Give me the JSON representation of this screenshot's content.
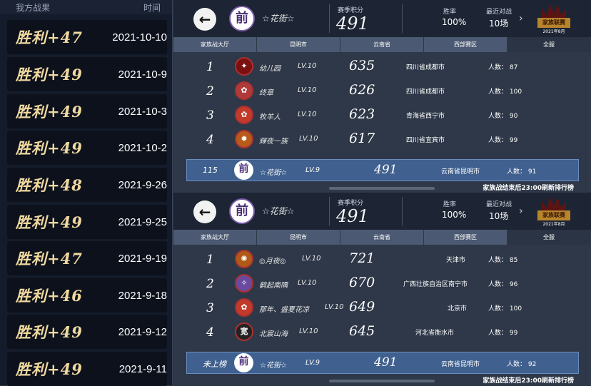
{
  "left": {
    "header_result": "我方战果",
    "header_time": "时间",
    "records": [
      {
        "result": "胜利+47",
        "date": "2021-10-10"
      },
      {
        "result": "胜利+49",
        "date": "2021-10-9"
      },
      {
        "result": "胜利+49",
        "date": "2021-10-3"
      },
      {
        "result": "胜利+49",
        "date": "2021-10-2"
      },
      {
        "result": "胜利+48",
        "date": "2021-9-26"
      },
      {
        "result": "胜利+49",
        "date": "2021-9-25"
      },
      {
        "result": "胜利+47",
        "date": "2021-9-19"
      },
      {
        "result": "胜利+46",
        "date": "2021-9-18"
      },
      {
        "result": "胜利+49",
        "date": "2021-9-12"
      },
      {
        "result": "胜利+49",
        "date": "2021-9-11"
      }
    ]
  },
  "panels": [
    {
      "back_icon": "arrow-left-icon",
      "avatar_char": "前",
      "clan_name": "☆花街☆",
      "season_label": "赛季积分",
      "season_value": "491",
      "win_rate_label": "胜率",
      "win_rate_value": "100%",
      "recent_label": "最近对战",
      "recent_value": "10场",
      "badge_title": "家族联赛",
      "badge_season": "2021年8月",
      "tabs": [
        "家族战大厅",
        "昆明市",
        "云南省",
        "西部赛区",
        "全服"
      ],
      "active_tab": 4,
      "rows": [
        {
          "rank": "1",
          "avatar": "✦",
          "name": "幼儿园",
          "level": "LV.10",
          "score": "635",
          "location": "四川省成都市",
          "people": "人数： 87"
        },
        {
          "rank": "2",
          "avatar": "✿",
          "name": "终章",
          "level": "LV.10",
          "score": "626",
          "location": "四川省成都市",
          "people": "人数： 100"
        },
        {
          "rank": "3",
          "avatar": "✿",
          "name": "牧羊人",
          "level": "LV.10",
          "score": "623",
          "location": "青海省西宁市",
          "people": "人数： 90"
        },
        {
          "rank": "4",
          "avatar": "✹",
          "name": "輝夜一族",
          "level": "LV.10",
          "score": "617",
          "location": "四川省宜宾市",
          "people": "人数： 99"
        }
      ],
      "mine": {
        "rank": "115",
        "avatar": "前",
        "name": "☆花街☆",
        "level": "LV.9",
        "score": "491",
        "location": "云南省昆明市",
        "people": "人数： 91"
      },
      "footer": "家族战结束后23:00刷新排行榜"
    },
    {
      "back_icon": "arrow-left-icon",
      "avatar_char": "前",
      "clan_name": "☆花街☆",
      "season_label": "赛季积分",
      "season_value": "491",
      "win_rate_label": "胜率",
      "win_rate_value": "100%",
      "recent_label": "最近对战",
      "recent_value": "10场",
      "badge_title": "家族联赛",
      "badge_season": "2021年8月",
      "tabs": [
        "家族战大厅",
        "昆明市",
        "云南省",
        "西部赛区",
        "全服"
      ],
      "active_tab": 4,
      "rows": [
        {
          "rank": "1",
          "avatar": "✺",
          "name": "◎月夜◎",
          "level": "LV.10",
          "score": "721",
          "location": "天津市",
          "people": "人数： 85"
        },
        {
          "rank": "2",
          "avatar": "✧",
          "name": "鹤起南隅",
          "level": "LV.10",
          "score": "670",
          "location": "广西壮族自治区南宁市",
          "people": "人数： 96"
        },
        {
          "rank": "3",
          "avatar": "✿",
          "name": "那年、盛夏花凉",
          "level": "LV.10",
          "score": "649",
          "location": "北京市",
          "people": "人数： 100"
        },
        {
          "rank": "4",
          "avatar": "宽",
          "name": "北宸山海",
          "level": "LV.10",
          "score": "645",
          "location": "河北省衡水市",
          "people": "人数： 99"
        }
      ],
      "mine": {
        "rank": "未上榜",
        "avatar": "前",
        "name": "☆花街☆",
        "level": "LV.9",
        "score": "491",
        "location": "云南省昆明市",
        "people": "人数： 92"
      },
      "footer": "家族战结束后23:00刷新排行榜"
    }
  ]
}
